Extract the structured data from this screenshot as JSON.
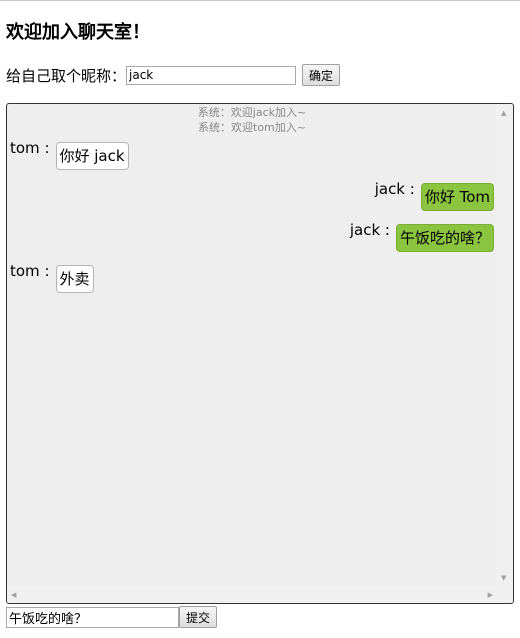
{
  "header": {
    "title": "欢迎加入聊天室！"
  },
  "nickname": {
    "label": "给自己取个昵称：",
    "value": "jack",
    "confirm_label": "确定"
  },
  "chat": {
    "system_messages": [
      "系统：欢迎jack加入~",
      "系统：欢迎tom加入~"
    ],
    "messages": [
      {
        "sender": "tom :",
        "text": "你好 jack",
        "side": "left"
      },
      {
        "sender": "jack :",
        "text": "你好 Tom",
        "side": "right"
      },
      {
        "sender": "jack :",
        "text": "午饭吃的啥？",
        "side": "right"
      },
      {
        "sender": "tom :",
        "text": "外卖",
        "side": "left"
      }
    ]
  },
  "composer": {
    "value": "午饭吃的啥？",
    "submit_label": "提交"
  },
  "colors": {
    "own_bubble": "#8bc43f",
    "chat_background": "#eeeeee"
  },
  "icons": [
    "scroll-up-arrow-icon",
    "scroll-down-arrow-icon",
    "scroll-left-arrow-icon",
    "scroll-right-arrow-icon"
  ]
}
